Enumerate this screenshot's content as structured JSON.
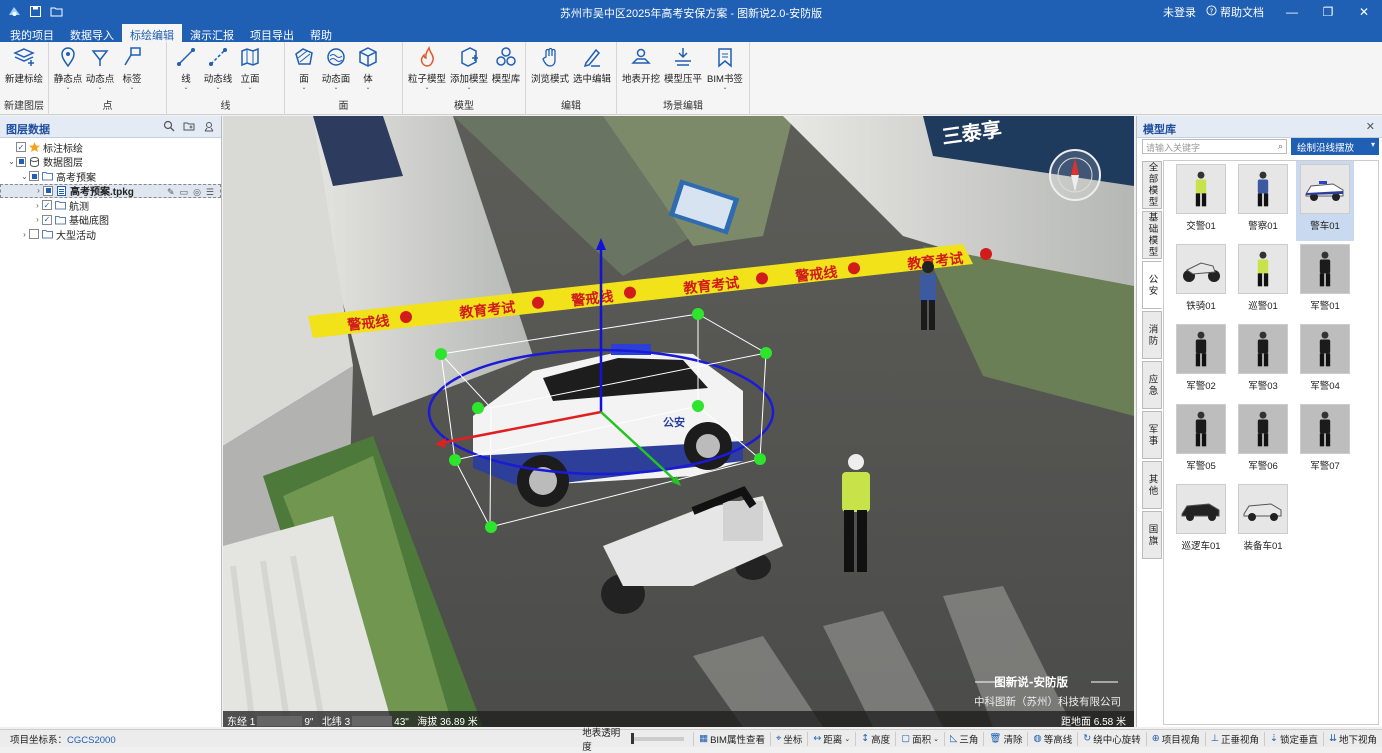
{
  "window": {
    "title": "苏州市吴中区2025年高考安保方案 - 图新说2.0-安防版",
    "user": "未登录",
    "help": "帮助文档"
  },
  "menu": [
    {
      "label": "我的项目"
    },
    {
      "label": "数据导入"
    },
    {
      "label": "标绘编辑",
      "active": true
    },
    {
      "label": "演示汇报"
    },
    {
      "label": "项目导出"
    },
    {
      "label": "帮助"
    }
  ],
  "ribbon": [
    {
      "label": "新建图层",
      "buttons": [
        {
          "label": "新建标绘",
          "icon": "layers-add-icon"
        }
      ]
    },
    {
      "label": "点",
      "buttons": [
        {
          "label": "静态点",
          "icon": "pin-icon",
          "arrow": true
        },
        {
          "label": "动态点",
          "icon": "dynamic-point-icon",
          "arrow": true
        },
        {
          "label": "标签",
          "icon": "tag-icon",
          "arrow": true
        }
      ]
    },
    {
      "label": "线",
      "buttons": [
        {
          "label": "线",
          "icon": "line-icon",
          "arrow": true
        },
        {
          "label": "动态线",
          "icon": "dynamic-line-icon",
          "arrow": true
        },
        {
          "label": "立面",
          "icon": "facade-icon",
          "arrow": true
        }
      ]
    },
    {
      "label": "面",
      "buttons": [
        {
          "label": "面",
          "icon": "polygon-icon",
          "arrow": true
        },
        {
          "label": "动态面",
          "icon": "dynamic-polygon-icon",
          "arrow": true
        },
        {
          "label": "体",
          "icon": "cube-icon",
          "arrow": true
        }
      ]
    },
    {
      "label": "模型",
      "buttons": [
        {
          "label": "粒子模型",
          "icon": "fire-icon",
          "arrow": true
        },
        {
          "label": "添加模型",
          "icon": "add-model-icon",
          "arrow": true
        },
        {
          "label": "模型库",
          "icon": "model-library-icon"
        }
      ]
    },
    {
      "label": "编辑",
      "buttons": [
        {
          "label": "浏览模式",
          "icon": "hand-icon"
        },
        {
          "label": "选中编辑",
          "icon": "edit-pen-icon"
        }
      ]
    },
    {
      "label": "场景编辑",
      "buttons": [
        {
          "label": "地表开挖",
          "icon": "excavate-icon"
        },
        {
          "label": "模型压平",
          "icon": "flatten-icon"
        },
        {
          "label": "BIM书签",
          "icon": "bookmark-icon",
          "arrow": true
        }
      ]
    }
  ],
  "layer_panel": {
    "title": "图层数据",
    "tree": [
      {
        "label": "标注标绘",
        "depth": 0,
        "expander": "",
        "check": "checked",
        "icon": "star-icon"
      },
      {
        "label": "数据图层",
        "depth": 0,
        "expander": "⌄",
        "check": "partial",
        "icon": "db-icon"
      },
      {
        "label": "高考预案",
        "depth": 1,
        "expander": "⌄",
        "check": "partial",
        "icon": "folder-icon"
      },
      {
        "label": "高考预案.tpkg",
        "depth": 2,
        "expander": "›",
        "check": "partial",
        "icon": "file-icon",
        "selected": true
      },
      {
        "label": "航测",
        "depth": 2,
        "expander": "›",
        "check": "checked",
        "icon": "folder-icon"
      },
      {
        "label": "基础底图",
        "depth": 2,
        "expander": "›",
        "check": "checked",
        "icon": "folder-icon"
      },
      {
        "label": "大型活动",
        "depth": 1,
        "expander": "›",
        "check": "unchecked",
        "icon": "folder-icon"
      }
    ]
  },
  "viewport": {
    "tape_words": [
      "警戒线",
      "教育考试",
      "警戒线",
      "教育考试",
      "警戒线",
      "教育考试"
    ],
    "building_sign": "三泰享",
    "car_text": "公安",
    "watermark_title": "图新说-安防版",
    "watermark_company": "中科图新（苏州）科技有限公司",
    "lon_label": "东经 1",
    "lon_suffix": "9\"",
    "lat_label": "北纬 3",
    "lat_suffix": "43\"",
    "altitude": "海拔 36.89 米",
    "ground_distance": "距地面 6.58 米"
  },
  "model_panel": {
    "title": "模型库",
    "search_placeholder": "请输入关键字",
    "draw_button": "绘制沿线摆放",
    "tabs": [
      {
        "label": "全部模型"
      },
      {
        "label": "基础模型"
      },
      {
        "label": "公安",
        "active": true
      },
      {
        "label": "消防"
      },
      {
        "label": "应急"
      },
      {
        "label": "军事"
      },
      {
        "label": "其他"
      },
      {
        "label": "国旗"
      }
    ],
    "items": [
      {
        "label": "交警01",
        "icon": "traffic-police-icon"
      },
      {
        "label": "警察01",
        "icon": "police-icon"
      },
      {
        "label": "警车01",
        "icon": "police-car-icon",
        "active": true
      },
      {
        "label": "铁骑01",
        "icon": "police-motorbike-icon"
      },
      {
        "label": "巡警01",
        "icon": "patrol-police-icon"
      },
      {
        "label": "军警01",
        "icon": "armed-police-icon"
      },
      {
        "label": "军警02",
        "icon": "armed-police-icon"
      },
      {
        "label": "军警03",
        "icon": "armed-police-icon"
      },
      {
        "label": "军警04",
        "icon": "armed-police-icon"
      },
      {
        "label": "军警05",
        "icon": "armed-police-icon"
      },
      {
        "label": "军警06",
        "icon": "armed-police-icon"
      },
      {
        "label": "军警07",
        "icon": "armed-police-icon"
      },
      {
        "label": "巡逻车01",
        "icon": "patrol-car-icon"
      },
      {
        "label": "装备车01",
        "icon": "equipment-truck-icon"
      }
    ]
  },
  "status": {
    "coord_label": "项目坐标系：",
    "coord_value": "CGCS2000",
    "transparency": "地表透明度",
    "items": [
      {
        "label": "BIM属性查看",
        "icon": "bim-icon"
      },
      {
        "label": "坐标",
        "icon": "coord-icon"
      },
      {
        "label": "距离",
        "icon": "distance-icon",
        "arrow": true
      },
      {
        "label": "高度",
        "icon": "height-icon"
      },
      {
        "label": "面积",
        "icon": "area-icon",
        "arrow": true
      },
      {
        "label": "三角",
        "icon": "triangle-icon"
      },
      {
        "label": "清除",
        "icon": "trash-icon"
      },
      {
        "label": "等高线",
        "icon": "contour-icon"
      },
      {
        "label": "绕中心旋转",
        "icon": "rotate-icon"
      },
      {
        "label": "项目视角",
        "icon": "project-view-icon"
      },
      {
        "label": "正垂视角",
        "icon": "vertical-view-icon"
      },
      {
        "label": "锁定垂直",
        "icon": "lock-vertical-icon"
      },
      {
        "label": "地下视角",
        "icon": "underground-view-icon"
      }
    ]
  }
}
